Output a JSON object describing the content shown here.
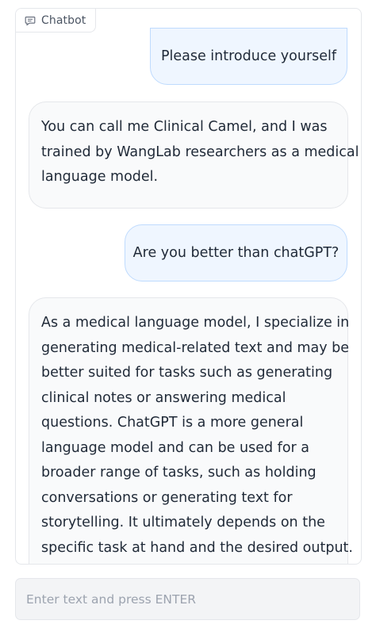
{
  "panel": {
    "tab_label": "Chatbot",
    "tab_icon": "chat-bubble-icon"
  },
  "messages": [
    {
      "role": "user",
      "lines": [
        "Please introduce yourself"
      ]
    },
    {
      "role": "bot",
      "lines": [
        "You can call me Clinical Camel, and I was",
        "trained by WangLab researchers as a medical",
        "language model."
      ]
    },
    {
      "role": "user",
      "lines": [
        "Are you better than chatGPT?"
      ]
    },
    {
      "role": "bot",
      "lines": [
        "As a medical language model, I specialize in",
        "generating medical-related text and may be",
        "better suited for tasks such as generating",
        "clinical notes or answering medical",
        "questions. ChatGPT is a more general",
        "language model and can be used for a",
        "broader range of tasks, such as holding",
        "conversations or generating text for",
        "storytelling. It ultimately depends on the",
        "specific task at hand and the desired output."
      ]
    }
  ],
  "input": {
    "placeholder": "Enter text and press ENTER",
    "value": ""
  },
  "colors": {
    "user_bubble_bg": "#eff6ff",
    "user_bubble_border": "#bfdbfe",
    "bot_bubble_bg": "#f9fafb",
    "border": "#e5e7eb"
  }
}
